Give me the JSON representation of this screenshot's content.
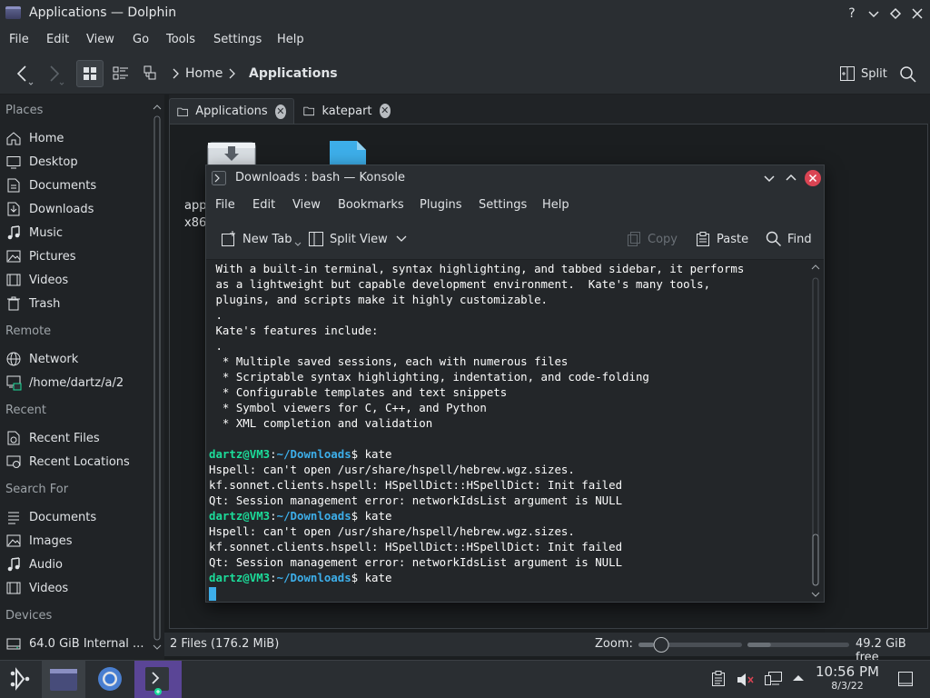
{
  "window": {
    "title": "Applications — Dolphin"
  },
  "menubar": [
    "File",
    "Edit",
    "View",
    "Go",
    "Tools",
    "Settings",
    "Help"
  ],
  "breadcrumb": {
    "home": "Home",
    "current": "Applications"
  },
  "toolbar": {
    "split": "Split"
  },
  "places": {
    "sections": [
      {
        "title": "Places",
        "items": [
          {
            "label": "Home",
            "icon": "home-icon"
          },
          {
            "label": "Desktop",
            "icon": "desktop-icon"
          },
          {
            "label": "Documents",
            "icon": "documents-icon"
          },
          {
            "label": "Downloads",
            "icon": "downloads-icon"
          },
          {
            "label": "Music",
            "icon": "music-icon"
          },
          {
            "label": "Pictures",
            "icon": "pictures-icon"
          },
          {
            "label": "Videos",
            "icon": "videos-icon"
          },
          {
            "label": "Trash",
            "icon": "trash-icon"
          }
        ]
      },
      {
        "title": "Remote",
        "items": [
          {
            "label": "Network",
            "icon": "network-icon"
          },
          {
            "label": "/home/dartz/a/2",
            "icon": "network-folder-icon"
          }
        ]
      },
      {
        "title": "Recent",
        "items": [
          {
            "label": "Recent Files",
            "icon": "recent-files-icon"
          },
          {
            "label": "Recent Locations",
            "icon": "recent-locations-icon"
          }
        ]
      },
      {
        "title": "Search For",
        "items": [
          {
            "label": "Documents",
            "icon": "search-documents-icon"
          },
          {
            "label": "Images",
            "icon": "search-images-icon"
          },
          {
            "label": "Audio",
            "icon": "search-audio-icon"
          },
          {
            "label": "Videos",
            "icon": "search-videos-icon"
          }
        ]
      },
      {
        "title": "Devices",
        "items": [
          {
            "label": "64.0 GiB Internal ...",
            "icon": "drive-icon"
          }
        ]
      }
    ]
  },
  "tabs": [
    {
      "label": "Applications"
    },
    {
      "label": "katepart"
    }
  ],
  "files": [
    {
      "label_line1": "app",
      "label_line2": "x86_",
      "icon": "download-appimage-icon"
    }
  ],
  "status": {
    "summary": "2 Files (176.2 MiB)",
    "zoom_label": "Zoom:",
    "zoom_level": 0.15,
    "free_space": "49.2 GiB free",
    "free_fraction": 0.23
  },
  "konsole": {
    "title": "Downloads : bash — Konsole",
    "menu": [
      "File",
      "Edit",
      "View",
      "Bookmarks",
      "Plugins",
      "Settings",
      "Help"
    ],
    "toolbar": {
      "new_tab": "New Tab",
      "split_view": "Split View",
      "copy": "Copy",
      "paste": "Paste",
      "find": "Find"
    },
    "lines": [
      {
        "t": "text",
        "s": " With a built-in terminal, syntax highlighting, and tabbed sidebar, it performs"
      },
      {
        "t": "text",
        "s": " as a lightweight but capable development environment.  Kate's many tools,"
      },
      {
        "t": "text",
        "s": " plugins, and scripts make it highly customizable."
      },
      {
        "t": "text",
        "s": " ."
      },
      {
        "t": "text",
        "s": " Kate's features include:"
      },
      {
        "t": "text",
        "s": " ."
      },
      {
        "t": "text",
        "s": "  * Multiple saved sessions, each with numerous files"
      },
      {
        "t": "text",
        "s": "  * Scriptable syntax highlighting, indentation, and code-folding"
      },
      {
        "t": "text",
        "s": "  * Configurable templates and text snippets"
      },
      {
        "t": "text",
        "s": "  * Symbol viewers for C, C++, and Python"
      },
      {
        "t": "text",
        "s": "  * XML completion and validation"
      },
      {
        "t": "text",
        "s": ""
      },
      {
        "t": "prompt",
        "user": "dartz@VM3",
        "path": "~/Downloads",
        "cmd": "$ kate"
      },
      {
        "t": "text",
        "s": "Hspell: can't open /usr/share/hspell/hebrew.wgz.sizes."
      },
      {
        "t": "text",
        "s": "kf.sonnet.clients.hspell: HSpellDict::HSpellDict: Init failed"
      },
      {
        "t": "text",
        "s": "Qt: Session management error: networkIdsList argument is NULL"
      },
      {
        "t": "prompt",
        "user": "dartz@VM3",
        "path": "~/Downloads",
        "cmd": "$ kate"
      },
      {
        "t": "text",
        "s": "Hspell: can't open /usr/share/hspell/hebrew.wgz.sizes."
      },
      {
        "t": "text",
        "s": "kf.sonnet.clients.hspell: HSpellDict::HSpellDict: Init failed"
      },
      {
        "t": "text",
        "s": "Qt: Session management error: networkIdsList argument is NULL"
      },
      {
        "t": "prompt",
        "user": "dartz@VM3",
        "path": "~/Downloads",
        "cmd": "$ kate"
      }
    ]
  },
  "taskbar": {
    "clock_time": "10:56 PM",
    "clock_date": "8/3/22",
    "apps": [
      "dolphin-taskbar-icon",
      "chromium-taskbar-icon",
      "konsole-taskbar-icon"
    ]
  },
  "colors": {
    "accent": "#3daee9",
    "close_red": "#da4453",
    "prompt_user": "#1cdc9a",
    "prompt_path": "#3daee9"
  }
}
